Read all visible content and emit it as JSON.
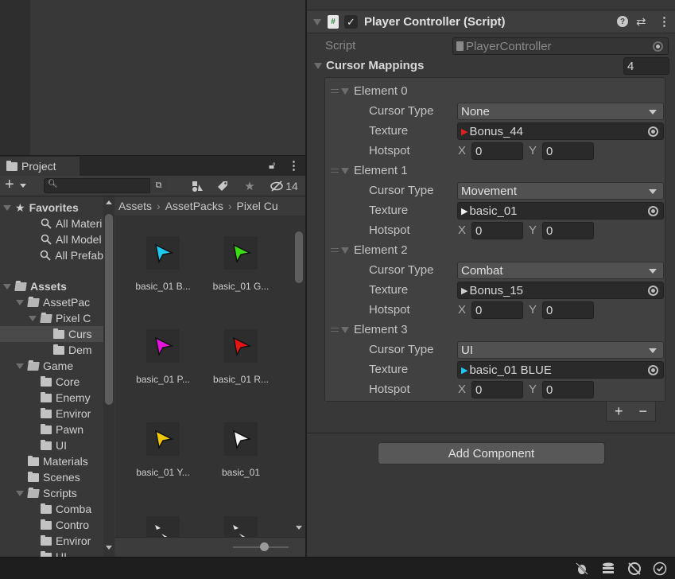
{
  "project": {
    "tab_label": "Project",
    "hidden_count": "14",
    "search_placeholder": "",
    "breadcrumb": [
      "Assets",
      "AssetPacks",
      "Pixel Cu"
    ],
    "tree": [
      {
        "label": "Favorites",
        "bold": true,
        "kind": "star"
      },
      {
        "label": "All Materi",
        "kind": "search"
      },
      {
        "label": "All Model",
        "kind": "search"
      },
      {
        "label": "All Prefab",
        "kind": "search"
      },
      {
        "label": "Assets",
        "bold": true,
        "kind": "folder-open"
      },
      {
        "label": "AssetPac",
        "kind": "folder-open"
      },
      {
        "label": "Pixel C",
        "kind": "folder-open"
      },
      {
        "label": "Curs",
        "kind": "folder",
        "selected": true
      },
      {
        "label": "Dem",
        "kind": "folder"
      },
      {
        "label": "Game",
        "kind": "folder-open"
      },
      {
        "label": "Core",
        "kind": "folder"
      },
      {
        "label": "Enemy",
        "kind": "folder"
      },
      {
        "label": "Enviror",
        "kind": "folder"
      },
      {
        "label": "Pawn",
        "kind": "folder"
      },
      {
        "label": "UI",
        "kind": "folder"
      },
      {
        "label": "Materials",
        "kind": "folder"
      },
      {
        "label": "Scenes",
        "kind": "folder"
      },
      {
        "label": "Scripts",
        "kind": "folder-open"
      },
      {
        "label": "Comba",
        "kind": "folder"
      },
      {
        "label": "Contro",
        "kind": "folder"
      },
      {
        "label": "Enviror",
        "kind": "folder"
      },
      {
        "label": "UI",
        "kind": "folder"
      }
    ],
    "assets": [
      {
        "label": "basic_01 B...",
        "color": "#1ec8f0"
      },
      {
        "label": "basic_01 G...",
        "color": "#3cdc14"
      },
      {
        "label": "basic_01 P...",
        "color": "#e614dc"
      },
      {
        "label": "basic_01 R...",
        "color": "#e61414"
      },
      {
        "label": "basic_01 Y...",
        "color": "#f0c80a"
      },
      {
        "label": "basic_01",
        "color": "#f5f5f5"
      },
      {
        "label": "",
        "color": "#e0e0e0"
      },
      {
        "label": "",
        "color": "#e0e0e0"
      }
    ]
  },
  "inspector": {
    "component_title": "Player Controller (Script)",
    "component_enabled": true,
    "script_label": "Script",
    "script_value": "PlayerController",
    "list_label": "Cursor Mappings",
    "list_size": "4",
    "field_labels": {
      "cursor_type": "Cursor Type",
      "texture": "Texture",
      "hotspot": "Hotspot",
      "x": "X",
      "y": "Y"
    },
    "elements": [
      {
        "name": "Element 0",
        "cursor_type": "None",
        "texture": "Bonus_44",
        "texture_icon_color": "#e02020",
        "hotspot_x": "0",
        "hotspot_y": "0"
      },
      {
        "name": "Element 1",
        "cursor_type": "Movement",
        "texture": "basic_01",
        "texture_icon_color": "#f0f0f0",
        "hotspot_x": "0",
        "hotspot_y": "0"
      },
      {
        "name": "Element 2",
        "cursor_type": "Combat",
        "texture": "Bonus_15",
        "texture_icon_color": "#d0d0d0",
        "hotspot_x": "0",
        "hotspot_y": "0"
      },
      {
        "name": "Element 3",
        "cursor_type": "UI",
        "texture": "basic_01 BLUE",
        "texture_icon_color": "#1ec8f0",
        "hotspot_x": "0",
        "hotspot_y": "0"
      }
    ],
    "add_label": "+",
    "remove_label": "−",
    "add_component_label": "Add Component"
  }
}
